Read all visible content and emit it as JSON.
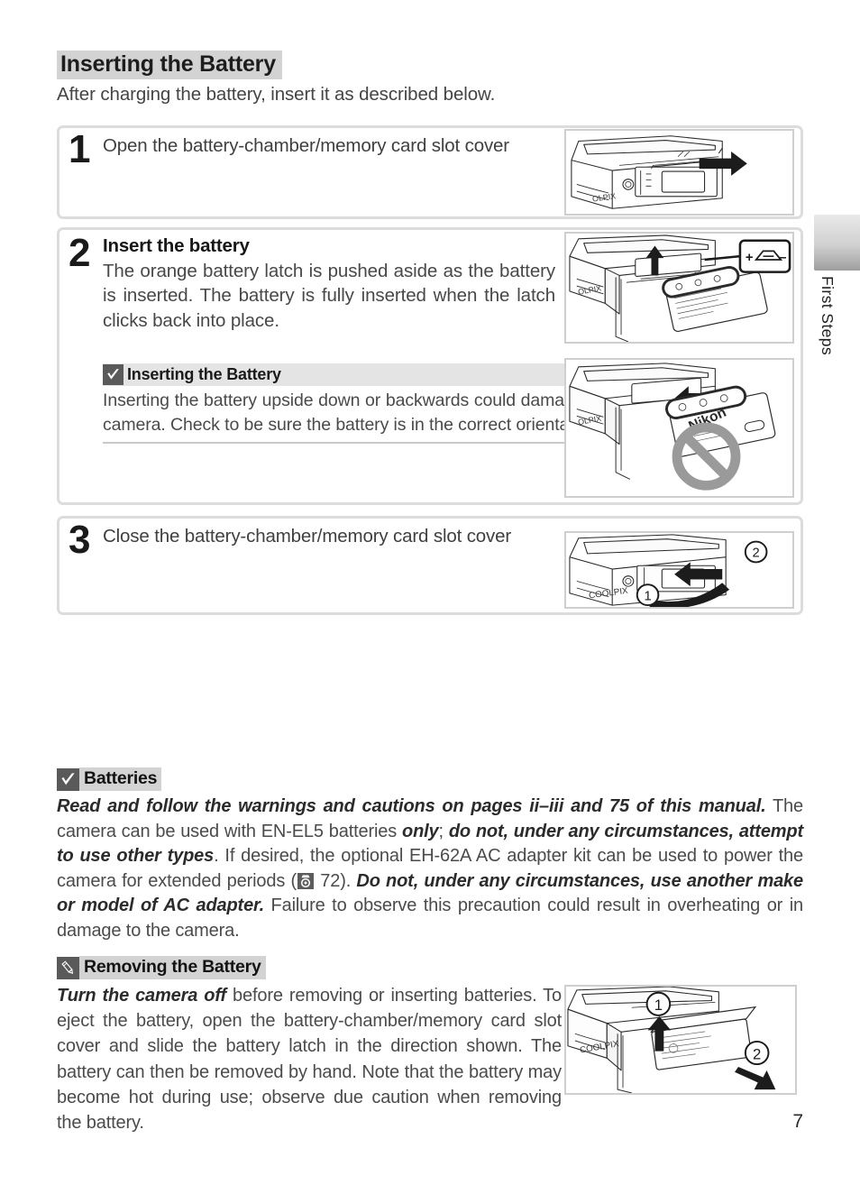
{
  "page": {
    "number": "7",
    "side_tab_label": "First Steps"
  },
  "section": {
    "title": "Inserting the Battery",
    "intro": "After charging the battery, insert it as described below."
  },
  "steps": [
    {
      "number": "1",
      "lead": "Open the battery-chamber/memory card slot cover",
      "illustration_name": "camera-bottom-open-cover-diagram"
    },
    {
      "number": "2",
      "title": "Insert the battery",
      "body": "The orange battery latch is pushed aside as the battery is inserted.  The battery is fully inserted when the latch clicks back into place.",
      "illustration_name": "battery-insert-diagram"
    },
    {
      "number": "3",
      "lead": "Close the battery-chamber/memory card slot cover",
      "illustration_name": "camera-close-cover-diagram"
    }
  ],
  "inline_note": {
    "icon": "checkmark-icon",
    "title": "Inserting the Battery",
    "text": "Inserting the battery upside down or backwards could damage the camera.  Check to be sure the battery is in the correct orientation."
  },
  "notes": [
    {
      "icon": "checkmark-icon",
      "title": "Batteries",
      "segments": [
        {
          "style": "bold-italic",
          "text": "Read and follow the warnings and cautions on pages ii–iii and 75 of this manual."
        },
        {
          "style": "plain",
          "text": "  The camera can be used with EN-EL5 batteries "
        },
        {
          "style": "bold-italic",
          "text": "only"
        },
        {
          "style": "plain",
          "text": "; "
        },
        {
          "style": "bold-italic",
          "text": "do not, under any circumstances, attempt to use other types"
        },
        {
          "style": "plain",
          "text": ".  If desired, the optional EH-62A AC adapter kit can be used to power the camera for extended periods ("
        },
        {
          "style": "ref-glyph",
          "text": ""
        },
        {
          "style": "plain",
          "text": " 72).  "
        },
        {
          "style": "bold-italic",
          "text": "Do not, under any circumstances, use another make or model of AC adapter."
        },
        {
          "style": "plain",
          "text": "  Failure to observe this precaution could result in overheating or in damage to the camera."
        }
      ]
    },
    {
      "icon": "pencil-icon",
      "title": "Removing the Battery",
      "segments": [
        {
          "style": "bold-italic",
          "text": "Turn the camera off"
        },
        {
          "style": "plain",
          "text": " before removing or inserting batteries. To eject the battery, open the battery-chamber/memory card slot cover and slide the battery latch in the direction shown. The battery can then be removed by hand.  Note that the battery may become hot during use; observe due caution when removing the battery."
        }
      ],
      "illustration_name": "battery-removal-diagram"
    }
  ],
  "illustration_labels": {
    "brand": "COOLPIX",
    "brand_partial": "OLPIX",
    "battery_brand": "Nikon",
    "callout_plus": "+",
    "callout_minus": "–",
    "step_marker_1": "①",
    "step_marker_2": "②"
  },
  "colors": {
    "highlight_gray": "#d3d3d3",
    "box_border": "#dcdcdc",
    "icon_box": "#5a5a5a",
    "text_gray": "#4b4b4b",
    "text_dark": "#1a1a1a",
    "prohibit_gray": "#9a9a9a"
  }
}
